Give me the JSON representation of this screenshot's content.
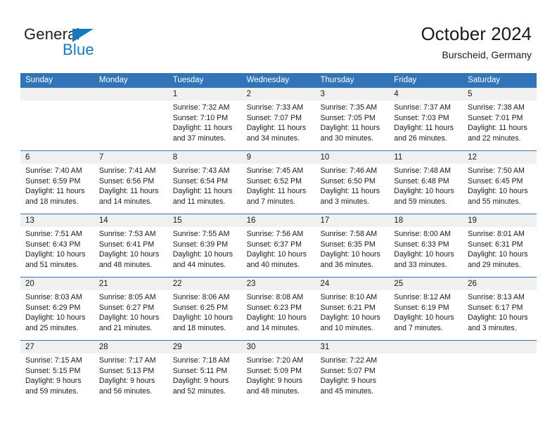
{
  "brand": {
    "line1": "General",
    "line2": "Blue",
    "triangle_icon": "triangle-icon",
    "color_dark": "#231f20",
    "color_blue": "#1479bd"
  },
  "header": {
    "title": "October 2024",
    "subtitle": "Burscheid, Germany"
  },
  "theme": {
    "header_blue": "#3175b8",
    "daynum_band": "#f0f0f0",
    "text": "#1a1a1a"
  },
  "weekdays": [
    "Sunday",
    "Monday",
    "Tuesday",
    "Wednesday",
    "Thursday",
    "Friday",
    "Saturday"
  ],
  "weeks": [
    {
      "days": [
        {
          "num": "",
          "sunrise": "",
          "sunset": "",
          "daylight_1": "",
          "daylight_2": "",
          "empty": true
        },
        {
          "num": "",
          "sunrise": "",
          "sunset": "",
          "daylight_1": "",
          "daylight_2": "",
          "empty": true
        },
        {
          "num": "1",
          "sunrise": "Sunrise: 7:32 AM",
          "sunset": "Sunset: 7:10 PM",
          "daylight_1": "Daylight: 11 hours",
          "daylight_2": "and 37 minutes."
        },
        {
          "num": "2",
          "sunrise": "Sunrise: 7:33 AM",
          "sunset": "Sunset: 7:07 PM",
          "daylight_1": "Daylight: 11 hours",
          "daylight_2": "and 34 minutes."
        },
        {
          "num": "3",
          "sunrise": "Sunrise: 7:35 AM",
          "sunset": "Sunset: 7:05 PM",
          "daylight_1": "Daylight: 11 hours",
          "daylight_2": "and 30 minutes."
        },
        {
          "num": "4",
          "sunrise": "Sunrise: 7:37 AM",
          "sunset": "Sunset: 7:03 PM",
          "daylight_1": "Daylight: 11 hours",
          "daylight_2": "and 26 minutes."
        },
        {
          "num": "5",
          "sunrise": "Sunrise: 7:38 AM",
          "sunset": "Sunset: 7:01 PM",
          "daylight_1": "Daylight: 11 hours",
          "daylight_2": "and 22 minutes."
        }
      ]
    },
    {
      "days": [
        {
          "num": "6",
          "sunrise": "Sunrise: 7:40 AM",
          "sunset": "Sunset: 6:59 PM",
          "daylight_1": "Daylight: 11 hours",
          "daylight_2": "and 18 minutes."
        },
        {
          "num": "7",
          "sunrise": "Sunrise: 7:41 AM",
          "sunset": "Sunset: 6:56 PM",
          "daylight_1": "Daylight: 11 hours",
          "daylight_2": "and 14 minutes."
        },
        {
          "num": "8",
          "sunrise": "Sunrise: 7:43 AM",
          "sunset": "Sunset: 6:54 PM",
          "daylight_1": "Daylight: 11 hours",
          "daylight_2": "and 11 minutes."
        },
        {
          "num": "9",
          "sunrise": "Sunrise: 7:45 AM",
          "sunset": "Sunset: 6:52 PM",
          "daylight_1": "Daylight: 11 hours",
          "daylight_2": "and 7 minutes."
        },
        {
          "num": "10",
          "sunrise": "Sunrise: 7:46 AM",
          "sunset": "Sunset: 6:50 PM",
          "daylight_1": "Daylight: 11 hours",
          "daylight_2": "and 3 minutes."
        },
        {
          "num": "11",
          "sunrise": "Sunrise: 7:48 AM",
          "sunset": "Sunset: 6:48 PM",
          "daylight_1": "Daylight: 10 hours",
          "daylight_2": "and 59 minutes."
        },
        {
          "num": "12",
          "sunrise": "Sunrise: 7:50 AM",
          "sunset": "Sunset: 6:45 PM",
          "daylight_1": "Daylight: 10 hours",
          "daylight_2": "and 55 minutes."
        }
      ]
    },
    {
      "days": [
        {
          "num": "13",
          "sunrise": "Sunrise: 7:51 AM",
          "sunset": "Sunset: 6:43 PM",
          "daylight_1": "Daylight: 10 hours",
          "daylight_2": "and 51 minutes."
        },
        {
          "num": "14",
          "sunrise": "Sunrise: 7:53 AM",
          "sunset": "Sunset: 6:41 PM",
          "daylight_1": "Daylight: 10 hours",
          "daylight_2": "and 48 minutes."
        },
        {
          "num": "15",
          "sunrise": "Sunrise: 7:55 AM",
          "sunset": "Sunset: 6:39 PM",
          "daylight_1": "Daylight: 10 hours",
          "daylight_2": "and 44 minutes."
        },
        {
          "num": "16",
          "sunrise": "Sunrise: 7:56 AM",
          "sunset": "Sunset: 6:37 PM",
          "daylight_1": "Daylight: 10 hours",
          "daylight_2": "and 40 minutes."
        },
        {
          "num": "17",
          "sunrise": "Sunrise: 7:58 AM",
          "sunset": "Sunset: 6:35 PM",
          "daylight_1": "Daylight: 10 hours",
          "daylight_2": "and 36 minutes."
        },
        {
          "num": "18",
          "sunrise": "Sunrise: 8:00 AM",
          "sunset": "Sunset: 6:33 PM",
          "daylight_1": "Daylight: 10 hours",
          "daylight_2": "and 33 minutes."
        },
        {
          "num": "19",
          "sunrise": "Sunrise: 8:01 AM",
          "sunset": "Sunset: 6:31 PM",
          "daylight_1": "Daylight: 10 hours",
          "daylight_2": "and 29 minutes."
        }
      ]
    },
    {
      "days": [
        {
          "num": "20",
          "sunrise": "Sunrise: 8:03 AM",
          "sunset": "Sunset: 6:29 PM",
          "daylight_1": "Daylight: 10 hours",
          "daylight_2": "and 25 minutes."
        },
        {
          "num": "21",
          "sunrise": "Sunrise: 8:05 AM",
          "sunset": "Sunset: 6:27 PM",
          "daylight_1": "Daylight: 10 hours",
          "daylight_2": "and 21 minutes."
        },
        {
          "num": "22",
          "sunrise": "Sunrise: 8:06 AM",
          "sunset": "Sunset: 6:25 PM",
          "daylight_1": "Daylight: 10 hours",
          "daylight_2": "and 18 minutes."
        },
        {
          "num": "23",
          "sunrise": "Sunrise: 8:08 AM",
          "sunset": "Sunset: 6:23 PM",
          "daylight_1": "Daylight: 10 hours",
          "daylight_2": "and 14 minutes."
        },
        {
          "num": "24",
          "sunrise": "Sunrise: 8:10 AM",
          "sunset": "Sunset: 6:21 PM",
          "daylight_1": "Daylight: 10 hours",
          "daylight_2": "and 10 minutes."
        },
        {
          "num": "25",
          "sunrise": "Sunrise: 8:12 AM",
          "sunset": "Sunset: 6:19 PM",
          "daylight_1": "Daylight: 10 hours",
          "daylight_2": "and 7 minutes."
        },
        {
          "num": "26",
          "sunrise": "Sunrise: 8:13 AM",
          "sunset": "Sunset: 6:17 PM",
          "daylight_1": "Daylight: 10 hours",
          "daylight_2": "and 3 minutes."
        }
      ]
    },
    {
      "days": [
        {
          "num": "27",
          "sunrise": "Sunrise: 7:15 AM",
          "sunset": "Sunset: 5:15 PM",
          "daylight_1": "Daylight: 9 hours",
          "daylight_2": "and 59 minutes."
        },
        {
          "num": "28",
          "sunrise": "Sunrise: 7:17 AM",
          "sunset": "Sunset: 5:13 PM",
          "daylight_1": "Daylight: 9 hours",
          "daylight_2": "and 56 minutes."
        },
        {
          "num": "29",
          "sunrise": "Sunrise: 7:18 AM",
          "sunset": "Sunset: 5:11 PM",
          "daylight_1": "Daylight: 9 hours",
          "daylight_2": "and 52 minutes."
        },
        {
          "num": "30",
          "sunrise": "Sunrise: 7:20 AM",
          "sunset": "Sunset: 5:09 PM",
          "daylight_1": "Daylight: 9 hours",
          "daylight_2": "and 48 minutes."
        },
        {
          "num": "31",
          "sunrise": "Sunrise: 7:22 AM",
          "sunset": "Sunset: 5:07 PM",
          "daylight_1": "Daylight: 9 hours",
          "daylight_2": "and 45 minutes."
        },
        {
          "num": "",
          "sunrise": "",
          "sunset": "",
          "daylight_1": "",
          "daylight_2": "",
          "empty": true
        },
        {
          "num": "",
          "sunrise": "",
          "sunset": "",
          "daylight_1": "",
          "daylight_2": "",
          "empty": true
        }
      ]
    }
  ]
}
